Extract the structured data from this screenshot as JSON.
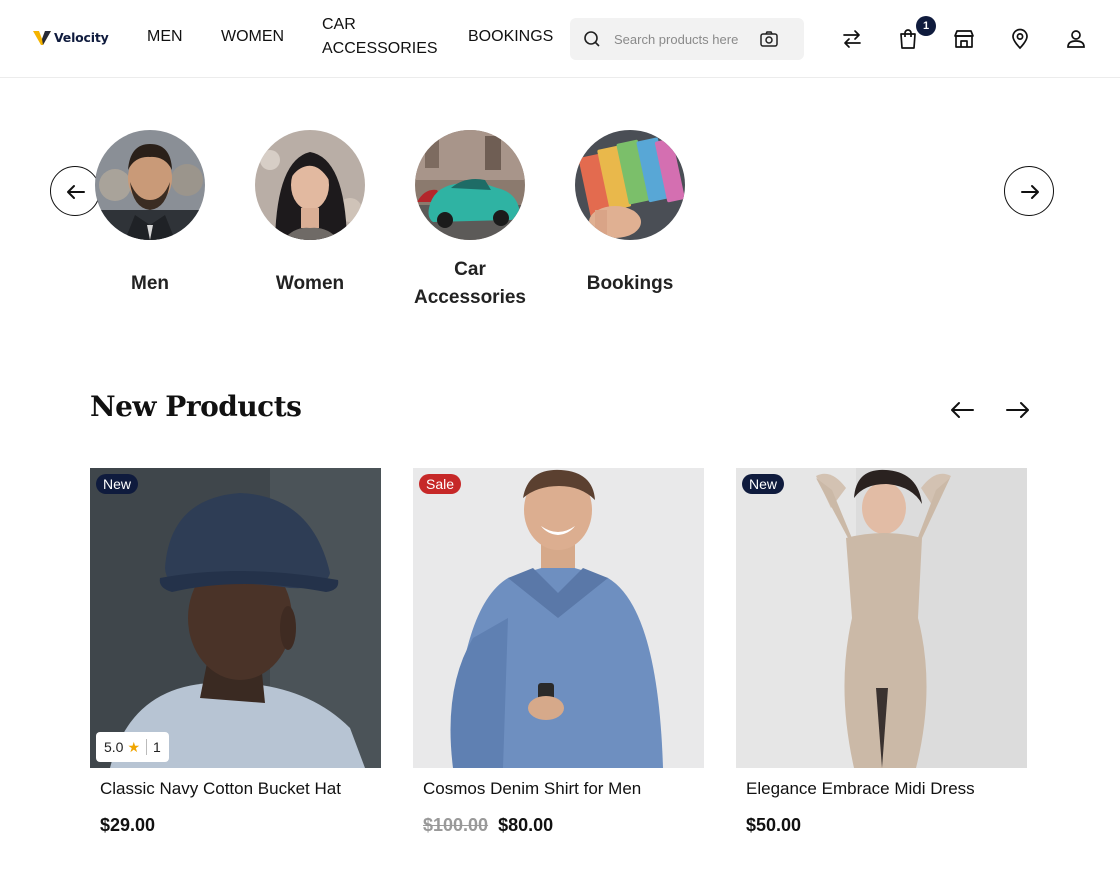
{
  "header": {
    "logo_text": "Velocity",
    "nav": [
      "MEN",
      "WOMEN",
      "CAR ACCESSORIES",
      "BOOKINGS"
    ],
    "search": {
      "placeholder": "Search products here"
    },
    "cart_count": "1",
    "icons": [
      "compare-arrows-icon",
      "shopping-bag-icon",
      "store-icon",
      "location-pin-icon",
      "user-icon"
    ]
  },
  "categories": [
    {
      "label": "Men"
    },
    {
      "label": "Women"
    },
    {
      "label": "Car Accessories"
    },
    {
      "label": "Bookings"
    }
  ],
  "new_products": {
    "title": "New Products",
    "items": [
      {
        "badge": "New",
        "name": "Classic Navy Cotton Bucket Hat",
        "price": "$29.00",
        "rating": "5.0",
        "reviews": "1"
      },
      {
        "badge": "Sale",
        "name": "Cosmos Denim Shirt for Men",
        "old_price": "$100.00",
        "price": "$80.00"
      },
      {
        "badge": "New",
        "name": "Elegance Embrace Midi Dress",
        "price": "$50.00"
      }
    ]
  },
  "colors": {
    "brand_navy": "#0f1b3d",
    "logo_accent": "#f5b400",
    "sale_red": "#c62828",
    "star": "#f0a500"
  }
}
